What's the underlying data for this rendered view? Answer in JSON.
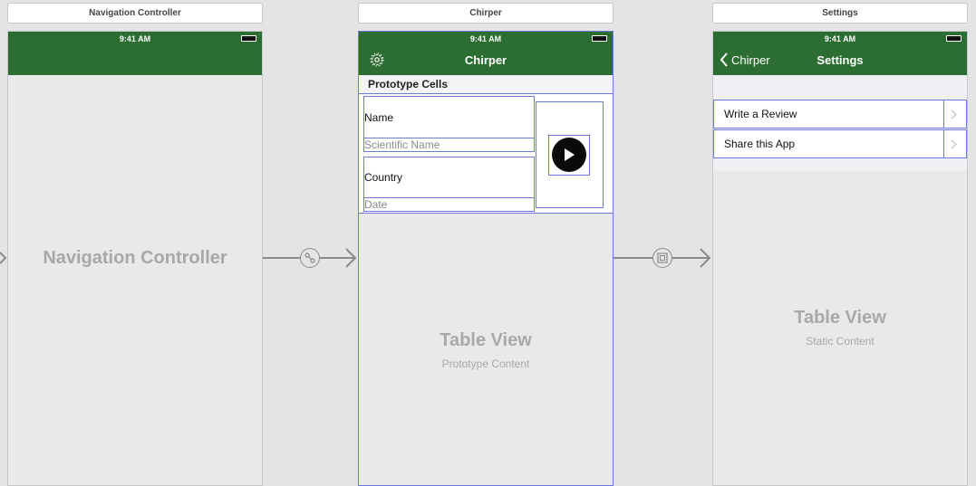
{
  "scenes": {
    "nav": {
      "title": "Navigation Controller",
      "time": "9:41 AM",
      "center_label": "Navigation Controller"
    },
    "chirper": {
      "title": "Chirper",
      "time": "9:41 AM",
      "nav_title": "Chirper",
      "section_header": "Prototype Cells",
      "cell": {
        "name": "Name",
        "scientific_name": "Scientific Name",
        "country": "Country",
        "date": "Date"
      },
      "table_label": "Table View",
      "table_sublabel": "Prototype Content"
    },
    "settings": {
      "title": "Settings",
      "time": "9:41 AM",
      "back_label": "Chirper",
      "nav_title": "Settings",
      "rows": [
        {
          "label": "Write a Review"
        },
        {
          "label": "Share this App"
        }
      ],
      "table_label": "Table View",
      "table_sublabel": "Static Content"
    }
  },
  "segues": [
    {
      "type": "relationship",
      "icon": "relationship-segue-icon"
    },
    {
      "type": "show",
      "icon": "show-segue-icon"
    }
  ],
  "colors": {
    "nav_bar": "#2c6e31",
    "canvas": "#e4e4e6",
    "selection_outline": "#6f79dd",
    "placeholder_text": "#a8a8a8"
  }
}
